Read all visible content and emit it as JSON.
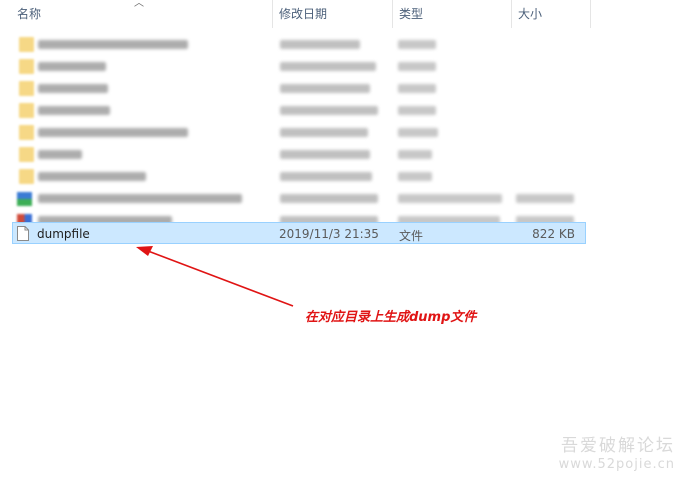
{
  "columns": {
    "name": "名称",
    "date_modified": "修改日期",
    "type": "类型",
    "size": "大小"
  },
  "selected_file": {
    "name": "dumpfile",
    "date_modified": "2019/11/3 21:35",
    "type": "文件",
    "size": "822 KB"
  },
  "annotation": "在对应目录上生成dump文件",
  "watermark": {
    "line1": "吾爱破解论坛",
    "line2": "www.52pojie.cn"
  },
  "colors": {
    "selection_bg": "#cce8ff",
    "selection_border": "#99d1ff",
    "annotation_red": "#e01414",
    "header_text": "#4c607a"
  }
}
